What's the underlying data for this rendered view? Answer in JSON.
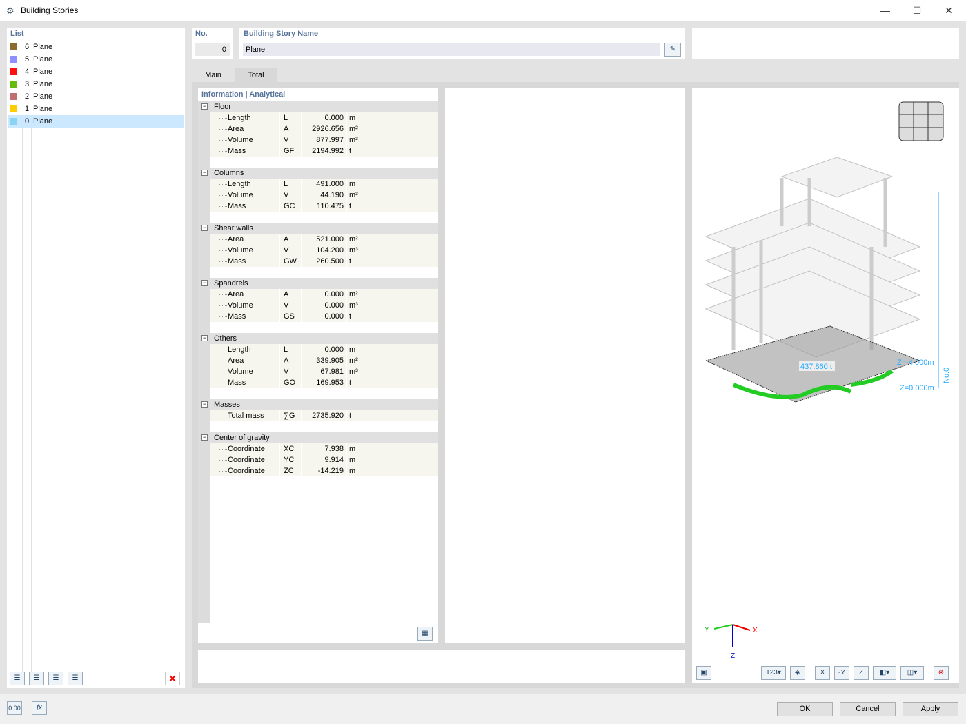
{
  "window": {
    "title": "Building Stories",
    "min": "—",
    "max": "☐",
    "close": "✕"
  },
  "list": {
    "label": "List",
    "items": [
      {
        "no": "6",
        "name": "Plane",
        "color": "#8b6a2e"
      },
      {
        "no": "5",
        "name": "Plane",
        "color": "#8f8fff"
      },
      {
        "no": "4",
        "name": "Plane",
        "color": "#ff1010"
      },
      {
        "no": "3",
        "name": "Plane",
        "color": "#66bb11"
      },
      {
        "no": "2",
        "name": "Plane",
        "color": "#c07070"
      },
      {
        "no": "1",
        "name": "Plane",
        "color": "#ffcc00"
      },
      {
        "no": "0",
        "name": "Plane",
        "color": "#88d4f4",
        "selected": true
      }
    ]
  },
  "header": {
    "no_label": "No.",
    "no_value": "0",
    "name_label": "Building Story Name",
    "name_value": "Plane"
  },
  "tabs": [
    {
      "label": "Main"
    },
    {
      "label": "Total",
      "active": true
    }
  ],
  "info": {
    "title": "Information | Analytical",
    "groups": [
      {
        "name": "Floor",
        "rows": [
          [
            "Length",
            "L",
            "0.000",
            "m"
          ],
          [
            "Area",
            "A",
            "2926.656",
            "m²"
          ],
          [
            "Volume",
            "V",
            "877.997",
            "m³"
          ],
          [
            "Mass",
            "GF",
            "2194.992",
            "t"
          ]
        ]
      },
      {
        "name": "Columns",
        "rows": [
          [
            "Length",
            "L",
            "491.000",
            "m"
          ],
          [
            "Volume",
            "V",
            "44.190",
            "m³"
          ],
          [
            "Mass",
            "GC",
            "110.475",
            "t"
          ]
        ]
      },
      {
        "name": "Shear walls",
        "rows": [
          [
            "Area",
            "A",
            "521.000",
            "m²"
          ],
          [
            "Volume",
            "V",
            "104.200",
            "m³"
          ],
          [
            "Mass",
            "GW",
            "260.500",
            "t"
          ]
        ]
      },
      {
        "name": "Spandrels",
        "rows": [
          [
            "Area",
            "A",
            "0.000",
            "m²"
          ],
          [
            "Volume",
            "V",
            "0.000",
            "m³"
          ],
          [
            "Mass",
            "GS",
            "0.000",
            "t"
          ]
        ]
      },
      {
        "name": "Others",
        "rows": [
          [
            "Length",
            "L",
            "0.000",
            "m"
          ],
          [
            "Area",
            "A",
            "339.905",
            "m²"
          ],
          [
            "Volume",
            "V",
            "67.981",
            "m³"
          ],
          [
            "Mass",
            "GO",
            "169.953",
            "t"
          ]
        ]
      },
      {
        "name": "Masses",
        "rows": [
          [
            "Total mass",
            "∑G",
            "2735.920",
            "t"
          ]
        ]
      },
      {
        "name": "Center of gravity",
        "rows": [
          [
            "Coordinate",
            "XC",
            "7.938",
            "m"
          ],
          [
            "Coordinate",
            "YC",
            "9.914",
            "m"
          ],
          [
            "Coordinate",
            "ZC",
            "-14.219",
            "m"
          ]
        ]
      }
    ]
  },
  "view": {
    "mass_label": "437.860 t",
    "z_top": "Z=-4.000m",
    "z_bottom": "Z=0.000m",
    "story": "No.0",
    "axis_x": "X",
    "axis_y": "Y",
    "axis_z": "Z"
  },
  "footer": {
    "ok": "OK",
    "cancel": "Cancel",
    "apply": "Apply",
    "units_icon": "0.00",
    "fx_icon": "fx"
  }
}
